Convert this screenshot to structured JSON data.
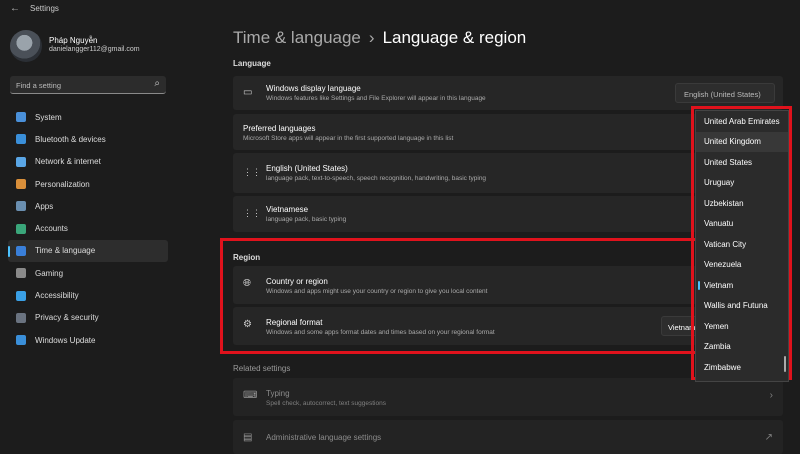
{
  "window": {
    "title": "Settings",
    "back_icon": "←"
  },
  "user": {
    "name": "Pháp Nguyễn",
    "email": "danielangger112@gmail.com"
  },
  "search": {
    "placeholder": "Find a setting",
    "icon": "⌕"
  },
  "nav": [
    {
      "label": "System",
      "color": "#4a90d9"
    },
    {
      "label": "Bluetooth & devices",
      "color": "#3a8fd9"
    },
    {
      "label": "Network & internet",
      "color": "#5aa6e6"
    },
    {
      "label": "Personalization",
      "color": "#d98f3a"
    },
    {
      "label": "Apps",
      "color": "#6a8fb0"
    },
    {
      "label": "Accounts",
      "color": "#3aa67a"
    },
    {
      "label": "Time & language",
      "color": "#3a7fd9",
      "active": true
    },
    {
      "label": "Gaming",
      "color": "#8a8a8a"
    },
    {
      "label": "Accessibility",
      "color": "#3aa0e6"
    },
    {
      "label": "Privacy & security",
      "color": "#6a7380"
    },
    {
      "label": "Windows Update",
      "color": "#3a8fd9"
    }
  ],
  "breadcrumb": {
    "parent": "Time & language",
    "separator": "›",
    "current": "Language & region"
  },
  "language": {
    "section_title": "Language",
    "display": {
      "title": "Windows display language",
      "subtitle": "Windows features like Settings and File Explorer will appear in this language",
      "value": "English (United States)"
    },
    "preferred": {
      "title": "Preferred languages",
      "subtitle": "Microsoft Store apps will appear in the first supported language in this list"
    },
    "items": [
      {
        "title": "English (United States)",
        "subtitle": "language pack, text-to-speech, speech recognition, handwriting, basic typing",
        "more": "···"
      },
      {
        "title": "Vietnamese",
        "subtitle": "language pack, basic typing",
        "more": "···"
      }
    ]
  },
  "region": {
    "section_title": "Region",
    "country": {
      "title": "Country or region",
      "subtitle": "Windows and apps might use your country or region to give you local content"
    },
    "format": {
      "title": "Regional format",
      "subtitle": "Windows and some apps format dates and times based on your regional format",
      "value": "Vietnam"
    }
  },
  "related": {
    "section_title": "Related settings",
    "typing": {
      "title": "Typing",
      "subtitle": "Spell check, autocorrect, text suggestions",
      "chevron": "›"
    },
    "admin": {
      "title": "Administrative language settings",
      "external": "↗"
    }
  },
  "popup": {
    "options": [
      "United Arab Emirates",
      "United Kingdom",
      "United States",
      "Uruguay",
      "Uzbekistan",
      "Vanuatu",
      "Vatican City",
      "Venezuela",
      "Vietnam",
      "Wallis and Futuna",
      "Yemen",
      "Zambia",
      "Zimbabwe"
    ],
    "highlighted": "United Kingdom",
    "selected": "Vietnam"
  },
  "colors": {
    "accent": "#4cc2ff",
    "highlight_border": "#e0121c"
  }
}
